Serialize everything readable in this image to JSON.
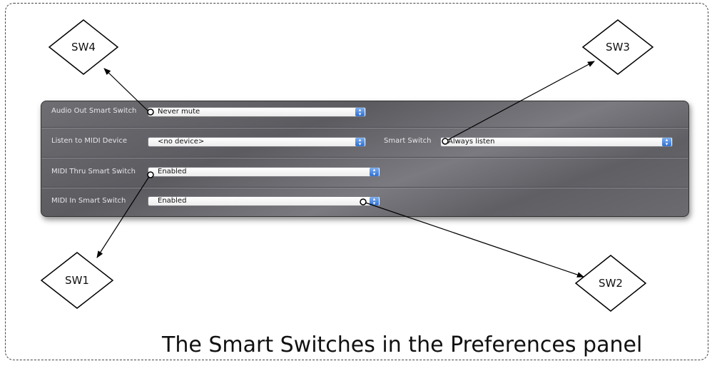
{
  "caption": "The Smart Switches in the Preferences panel",
  "panel": {
    "audio_out": {
      "label": "Audio Out Smart Switch",
      "value": "Never mute"
    },
    "listen_midi": {
      "label": "Listen to MIDI Device",
      "value": "<no device>"
    },
    "smart_switch": {
      "label": "Smart Switch",
      "value": "Always listen"
    },
    "midi_thru": {
      "label": "MIDI Thru Smart Switch",
      "value": "Enabled"
    },
    "midi_in": {
      "label": "MIDI In Smart Switch",
      "value": "Enabled"
    }
  },
  "callouts": {
    "sw1": "SW1",
    "sw2": "SW2",
    "sw3": "SW3",
    "sw4": "SW4"
  },
  "icons": {
    "popup_arrows": "up-down-arrows-icon"
  }
}
